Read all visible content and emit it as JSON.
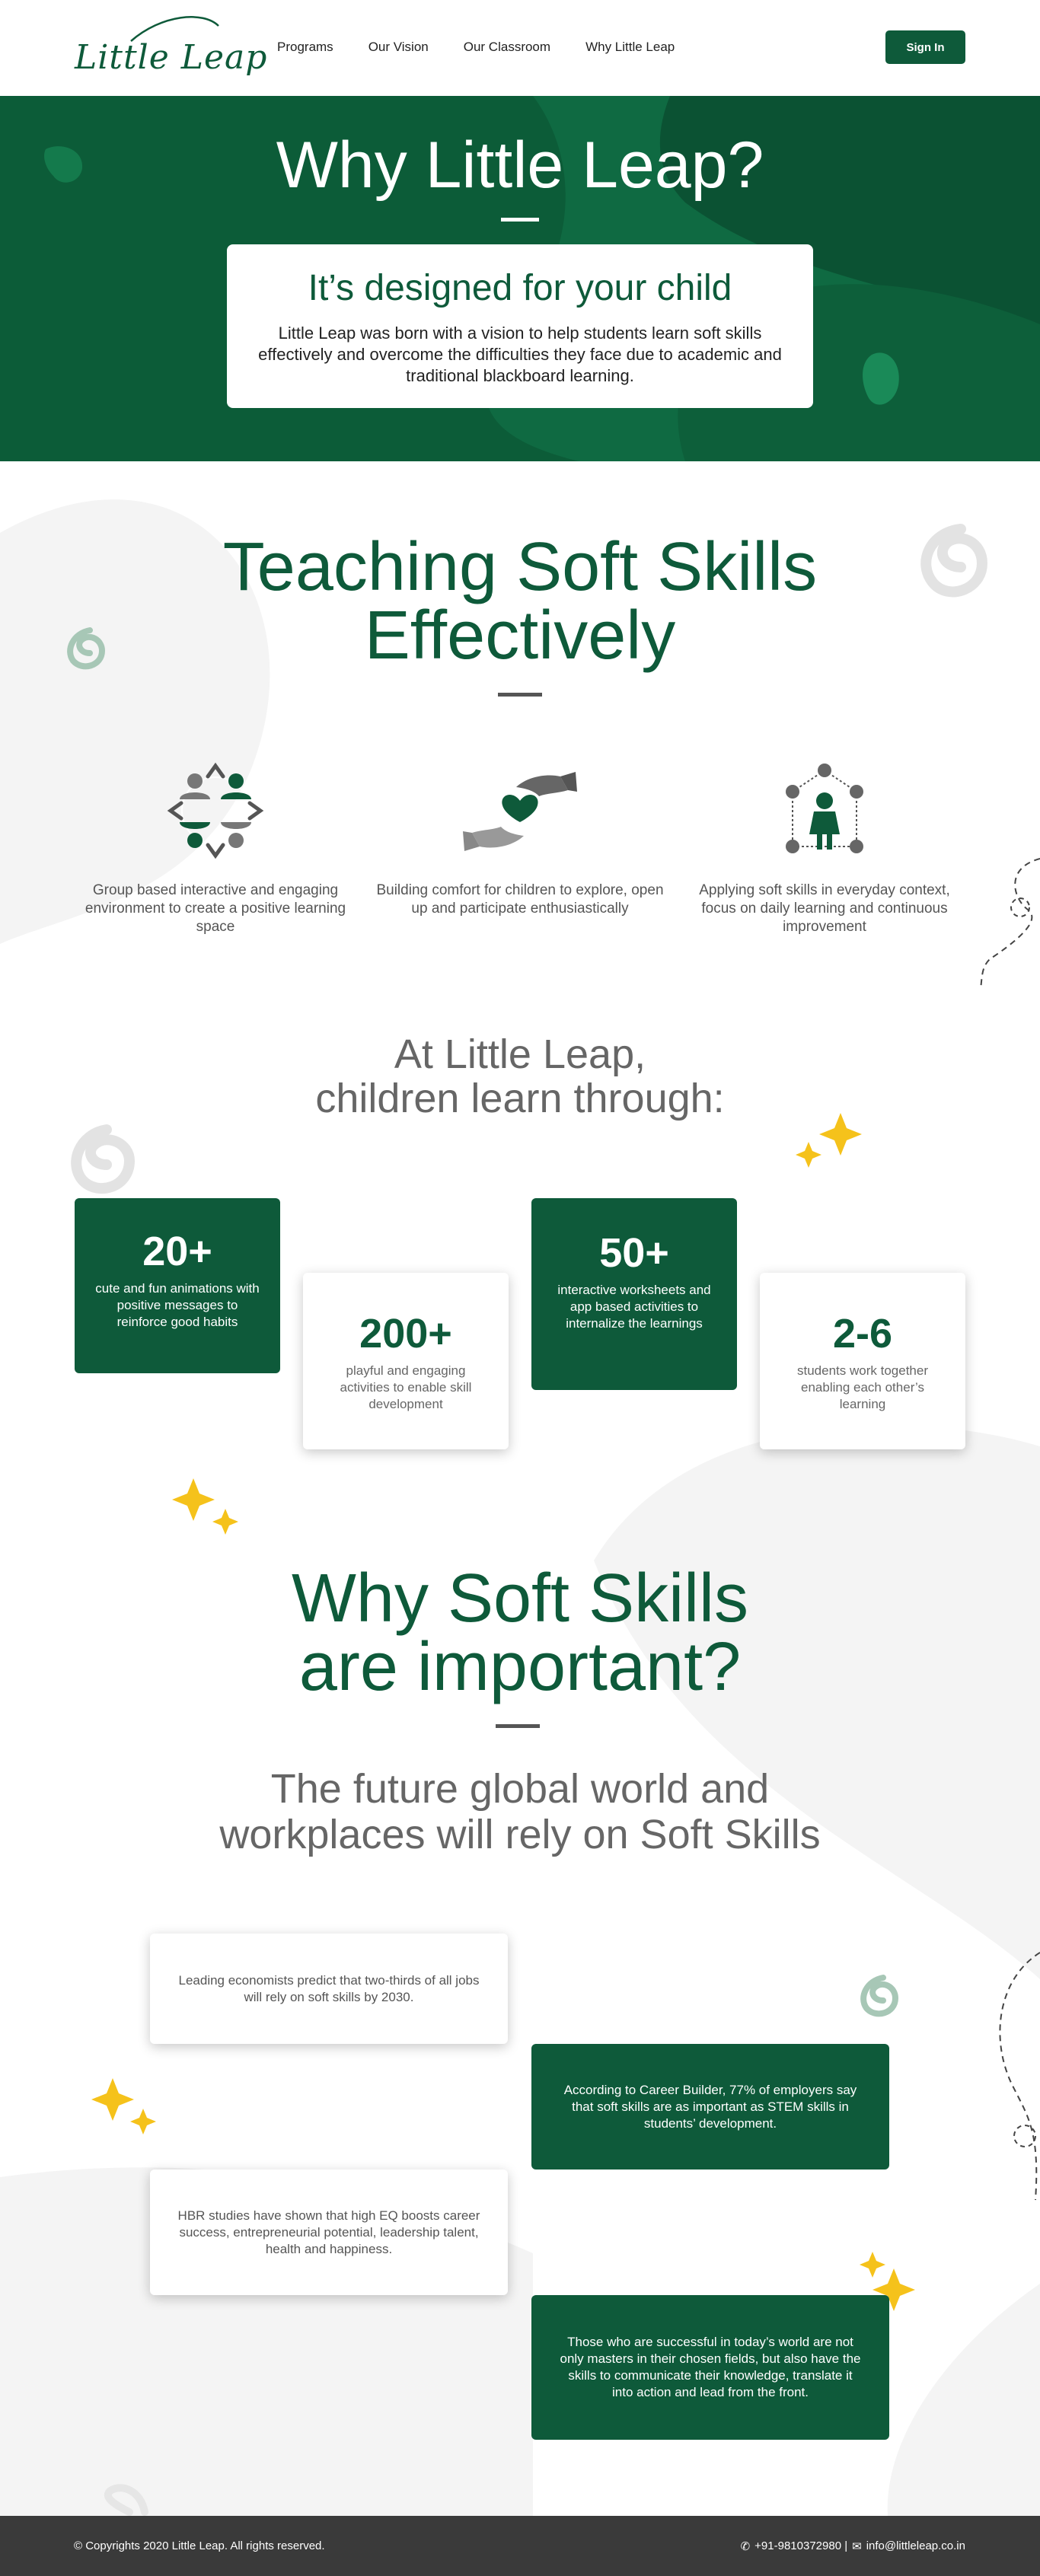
{
  "nav": {
    "logo_text": "Little Leap",
    "links": [
      "Programs",
      "Our Vision",
      "Our Classroom",
      "Why Little Leap"
    ],
    "signin_label": "Sign In"
  },
  "hero": {
    "title": "Why Little Leap?",
    "card_title": "It’s designed for your child",
    "card_text": "Little Leap was born with a vision to help students learn soft skills effectively and overcome the difficulties they face due to academic and traditional blackboard learning."
  },
  "teaching": {
    "title_line1": "Teaching Soft Skills",
    "title_line2": "Effectively",
    "features": [
      {
        "icon": "group-people-icon",
        "text": "Group based interactive and engaging environment to create a positive learning space"
      },
      {
        "icon": "hands-heart-icon",
        "text": "Building comfort for children to explore, open up and participate enthusiastically"
      },
      {
        "icon": "child-network-icon",
        "text": "Applying soft skills in everyday context, focus on daily learning and continuous improvement"
      }
    ]
  },
  "learn": {
    "title_line1": "At Little Leap,",
    "title_line2": "children learn through:",
    "stats": [
      {
        "number": "20+",
        "text": "cute and fun animations with positive messages to reinforce good habits"
      },
      {
        "number": "200+",
        "text": "playful and engaging activities to enable skill development"
      },
      {
        "number": "50+",
        "text": "interactive worksheets and app based activities to internalize the learnings"
      },
      {
        "number": "2-6",
        "text": "students work together enabling each other’s learning"
      }
    ]
  },
  "importance": {
    "title_line1": "Why Soft Skills",
    "title_line2": "are important?",
    "subtitle_line1": "The future global world and",
    "subtitle_line2": "workplaces will rely on Soft Skills",
    "facts": [
      "Leading economists predict that two-thirds of all jobs will rely on soft skills by 2030.",
      "According to Career Builder, 77% of employers say that soft skills are as important as STEM skills in students’ development.",
      "HBR studies have shown that high EQ boosts career success, entrepreneurial potential, leadership talent, health and happiness.",
      "Those who are successful in today’s world are not only masters in their chosen fields, but also have the skills to communicate their knowledge, translate it into action and lead from the front."
    ]
  },
  "footer": {
    "copyright": "© Copyrights 2020 Little Leap. All rights reserved.",
    "phone": "+91-9810372980 |",
    "email": "info@littleleap.co.in"
  },
  "colors": {
    "brand_green": "#0e5a3a",
    "hero_green": "#0f6a42",
    "accent_yellow": "#f5c21b",
    "footer_bg": "#3a3a3a"
  }
}
